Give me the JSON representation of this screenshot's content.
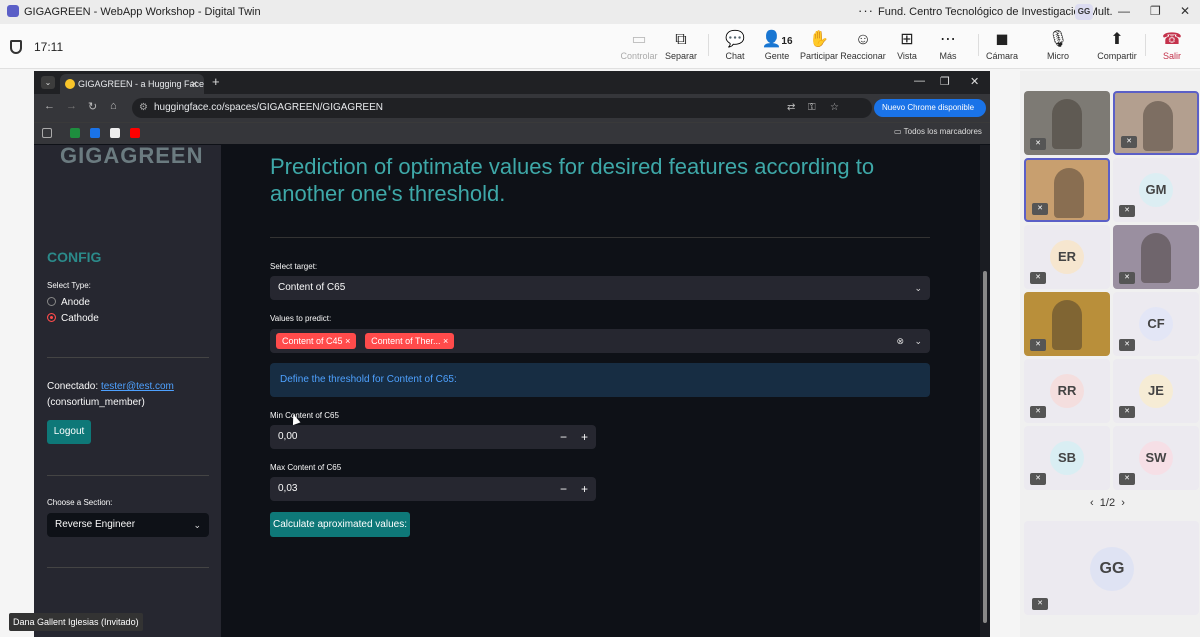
{
  "window": {
    "title": "GIGAGREEN - WebApp Workshop - Digital Twin",
    "org": "Fund. Centro Tecnológico de Investigación Mult.",
    "user_initials": "GG"
  },
  "toolbar": {
    "time": "17:11",
    "buttons": [
      {
        "label": "Controlar",
        "icon": "remote-control-icon",
        "glyph": "▭",
        "disabled": true
      },
      {
        "label": "Separar",
        "icon": "popout-icon",
        "glyph": "⧉"
      },
      {
        "label": "Chat",
        "icon": "chat-icon",
        "glyph": "💬"
      },
      {
        "label": "Gente",
        "icon": "people-icon",
        "glyph": "👤",
        "badge": "16"
      },
      {
        "label": "Participar",
        "icon": "raise-hand-icon",
        "glyph": "✋"
      },
      {
        "label": "Reaccionar",
        "icon": "react-icon",
        "glyph": "☺"
      },
      {
        "label": "Vista",
        "icon": "view-icon",
        "glyph": "⊞"
      },
      {
        "label": "Más",
        "icon": "more-icon",
        "glyph": "⋯"
      },
      {
        "label": "Cámara",
        "icon": "camera-off-icon",
        "glyph": "◼"
      },
      {
        "label": "Micro",
        "icon": "mic-off-icon",
        "glyph": "🎙"
      },
      {
        "label": "Compartir",
        "icon": "share-icon",
        "glyph": "⬆"
      },
      {
        "label": "Salir",
        "icon": "hangup-icon",
        "glyph": "☎"
      }
    ]
  },
  "browser": {
    "tab_title": "GIGAGREEN - a Hugging Face S",
    "url": "huggingface.co/spaces/GIGAGREEN/GIGAGREEN",
    "chrome_button": "Nuevo Chrome disponible",
    "all_bookmarks": "Todos los marcadores"
  },
  "sidebar": {
    "logo": "GIGAGREEN",
    "config_title": "CONFIG",
    "select_type_label": "Select Type:",
    "types": [
      "Anode",
      "Cathode"
    ],
    "selected_type": "Cathode",
    "connected_label": "Conectado:",
    "email": "tester@test.com",
    "role": "(consortium_member)",
    "logout": "Logout",
    "section_label": "Choose a Section:",
    "section_value": "Reverse Engineer"
  },
  "main": {
    "heading": "Prediction of optimate values for desired features according to another one's threshold.",
    "target_label": "Select target:",
    "target_value": "Content of C65",
    "predict_label": "Values to predict:",
    "predict_chips": [
      "Content of C45",
      "Content of Ther..."
    ],
    "info_text": "Define the threshold for Content of C65:",
    "min_label": "Min Content of C65",
    "min_value": "0,00",
    "max_label": "Max Content of C65",
    "max_value": "0,03",
    "calc_button": "Calculate aproximated values:"
  },
  "gallery": {
    "participants": [
      "",
      "",
      "",
      "GM",
      "ER",
      "",
      "",
      "CF",
      "RR",
      "JE",
      "SB",
      "SW"
    ],
    "page": "1/2",
    "big_tile": "GG"
  },
  "name_tag": "Dana Gallent Iglesias (Invitado)"
}
